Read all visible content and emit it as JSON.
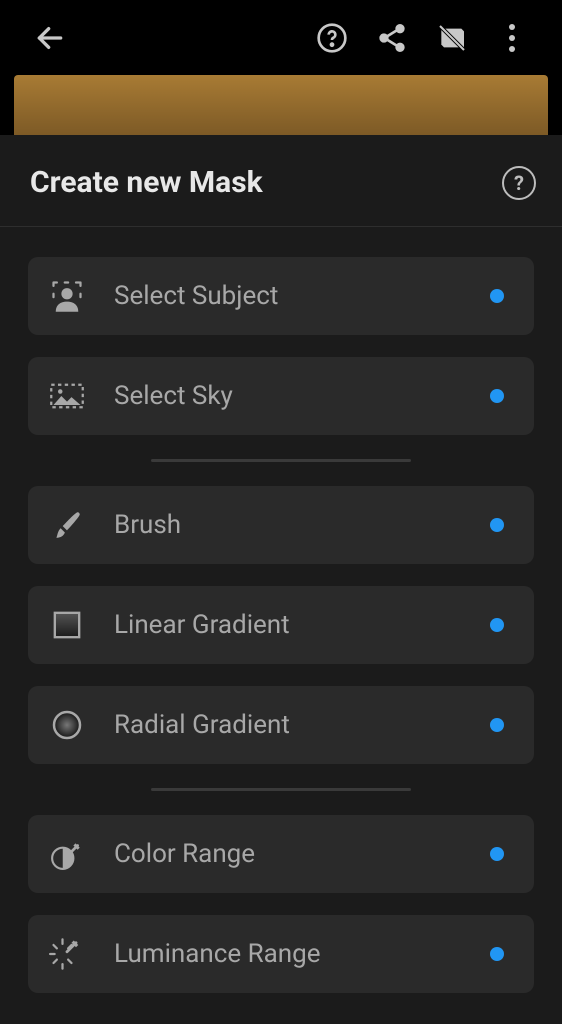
{
  "topbar": {
    "back": "back",
    "help": "help",
    "share": "share",
    "layers": "layers",
    "more": "more"
  },
  "panel": {
    "title": "Create new Mask",
    "help": "?"
  },
  "options": [
    {
      "label": "Select Subject",
      "icon": "select-subject"
    },
    {
      "label": "Select Sky",
      "icon": "select-sky"
    },
    {
      "label": "Brush",
      "icon": "brush"
    },
    {
      "label": "Linear Gradient",
      "icon": "linear-gradient"
    },
    {
      "label": "Radial Gradient",
      "icon": "radial-gradient"
    },
    {
      "label": "Color Range",
      "icon": "color-range"
    },
    {
      "label": "Luminance Range",
      "icon": "luminance-range"
    }
  ]
}
